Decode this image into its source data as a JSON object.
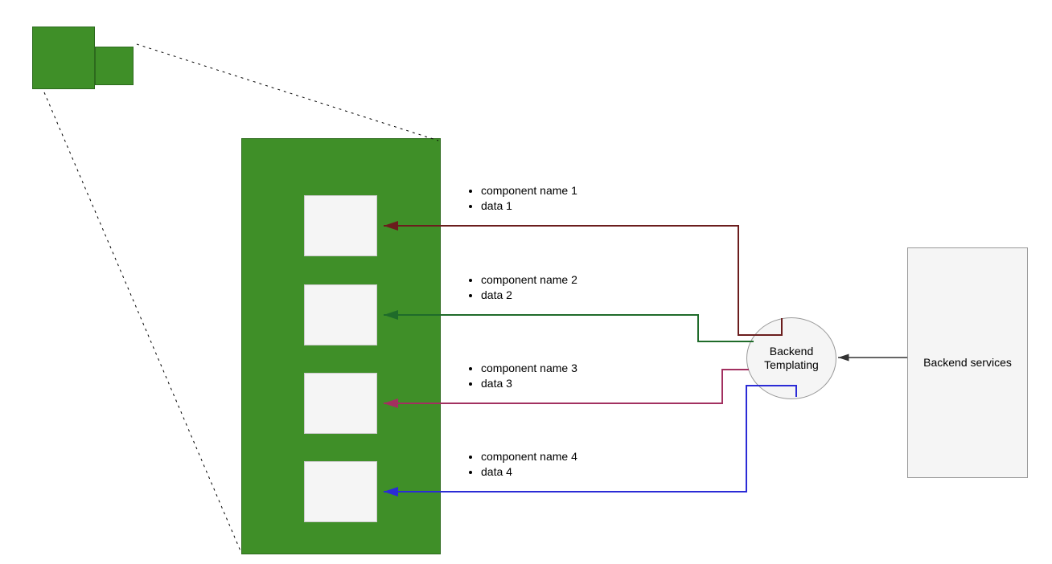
{
  "colors": {
    "green": "#3f8f28",
    "line1": "#6b1d1d",
    "line2": "#1f6b2a",
    "line3": "#a23060",
    "line4": "#2b2bd6",
    "neutral": "#333333"
  },
  "small_icon": {
    "note": "overlapping green squares top-left"
  },
  "panel": {
    "note": "large green panel with 4 white component slots"
  },
  "components": [
    {
      "name": "component name 1",
      "data": "data 1"
    },
    {
      "name": "component name 2",
      "data": "data 2"
    },
    {
      "name": "component name 3",
      "data": "data 3"
    },
    {
      "name": "component name 4",
      "data": "data 4"
    }
  ],
  "backend_templating": "Backend Templating",
  "backend_services": "Backend services"
}
